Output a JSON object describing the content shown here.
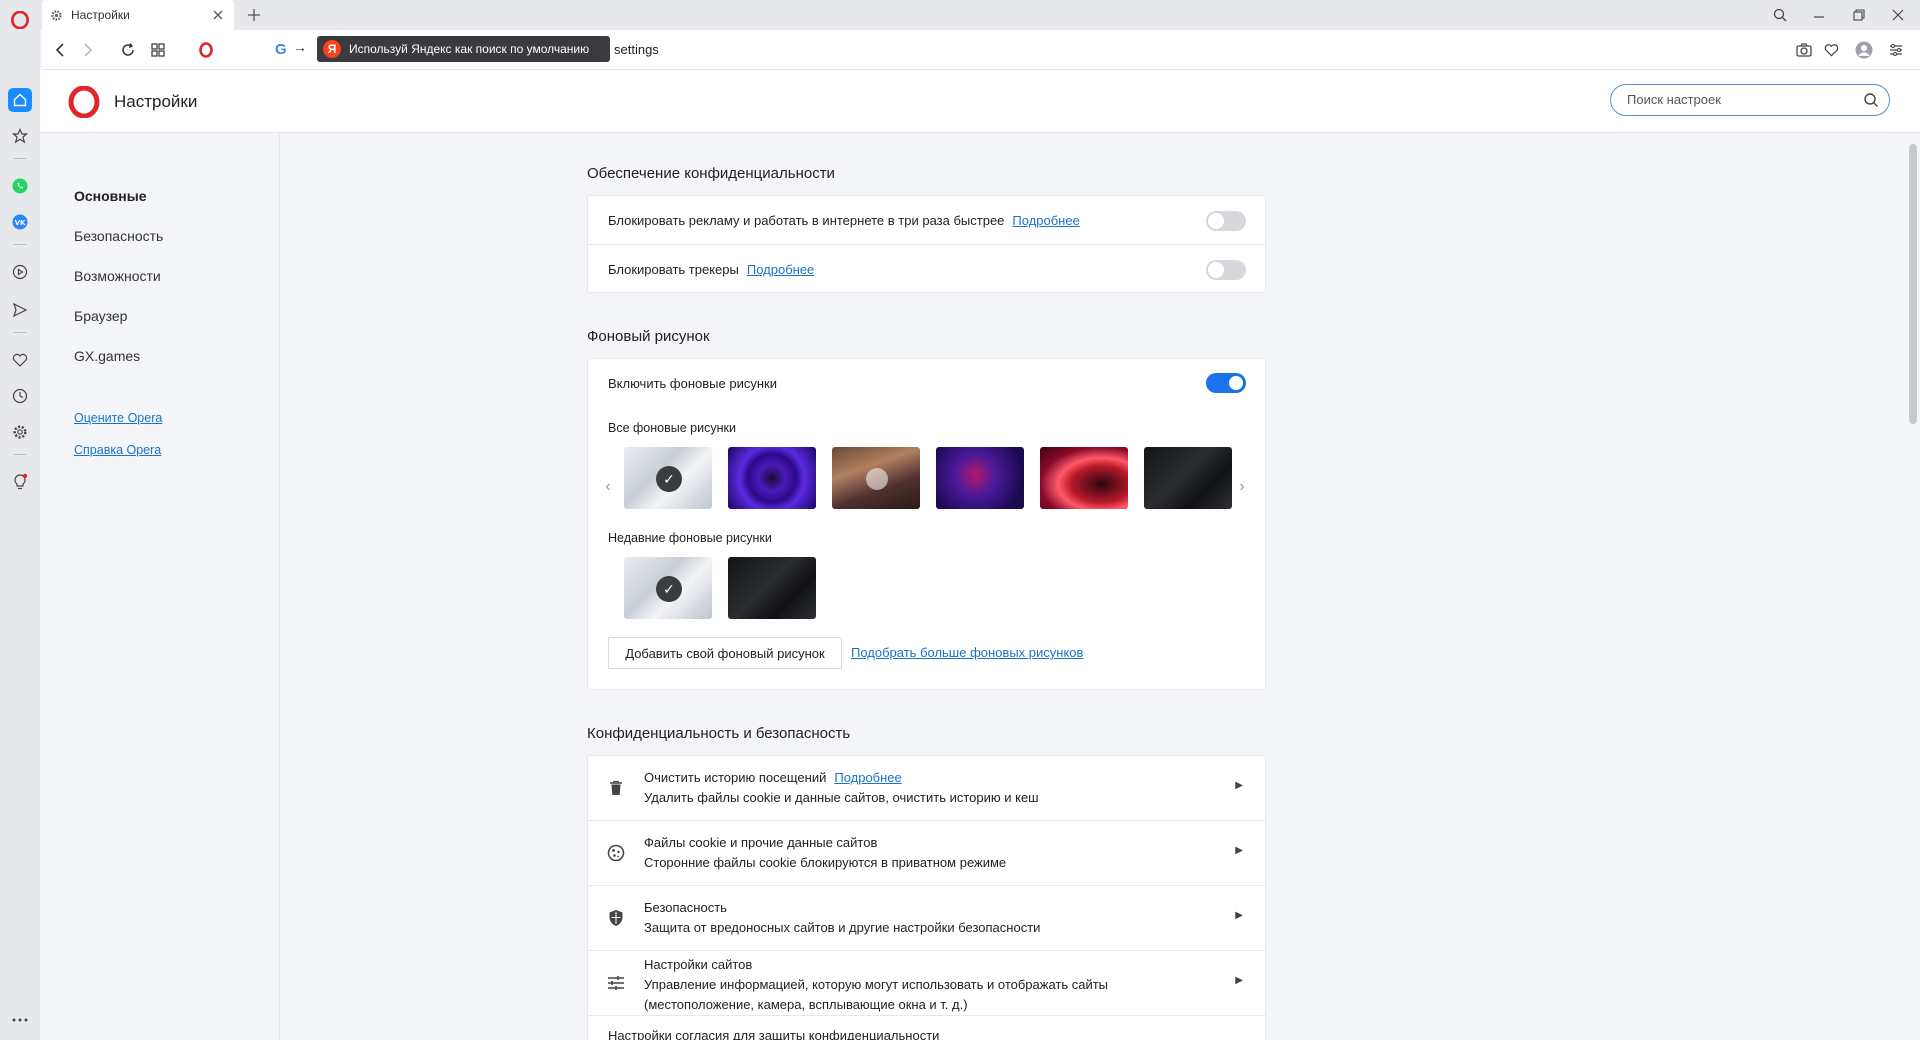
{
  "tab": {
    "title": "Настройки"
  },
  "addressbar": {
    "url": "settings",
    "yandex_tip": "Используй Яндекс как поиск по умолчанию",
    "yandex_logo": "Я",
    "google_logo": "G"
  },
  "page": {
    "title": "Настройки",
    "search_placeholder": "Поиск настроек"
  },
  "leftnav": {
    "items": [
      "Основные",
      "Безопасность",
      "Возможности",
      "Браузер",
      "GX.games"
    ],
    "links": [
      "Оцените Opera",
      "Справка Opera"
    ]
  },
  "privacy_block": {
    "title": "Обеспечение конфиденциальности",
    "rows": [
      {
        "label": "Блокировать рекламу и работать в интернете в три раза быстрее",
        "link": "Подробнее",
        "enabled": false
      },
      {
        "label": "Блокировать трекеры",
        "link": "Подробнее",
        "enabled": false
      }
    ]
  },
  "wallpaper": {
    "title": "Фоновый рисунок",
    "enable_label": "Включить фоновые рисунки",
    "enabled": true,
    "all_label": "Все фоновые рисунки",
    "recent_label": "Недавние фоновые рисунки",
    "add_button": "Добавить свой фоновый рисунок",
    "more_link": "Подобрать больше фоновых рисунков"
  },
  "privacy_security": {
    "title": "Конфиденциальность и безопасность",
    "rows": [
      {
        "icon": "trash-icon",
        "title": "Очистить историю посещений",
        "link": "Подробнее",
        "sub": "Удалить файлы cookie и данные сайтов, очистить историю и кеш"
      },
      {
        "icon": "cookie-icon",
        "title": "Файлы cookie и прочие данные сайтов",
        "sub": "Сторонние файлы cookie блокируются в приватном режиме"
      },
      {
        "icon": "shield-icon",
        "title": "Безопасность",
        "sub": "Защита от вредоносных сайтов и другие настройки безопасности"
      },
      {
        "icon": "sliders-icon",
        "title": "Настройки сайтов",
        "sub": "Управление информацией, которую могут использовать и отображать сайты",
        "sub2": "(местоположение, камера, всплывающие окна и т. д.)"
      },
      {
        "title": "Настройки согласия для защиты конфиденциальности"
      }
    ]
  },
  "colors": {
    "accent": "#1a73e8",
    "link": "#1a73c8",
    "opera_red": "#e0252b"
  }
}
